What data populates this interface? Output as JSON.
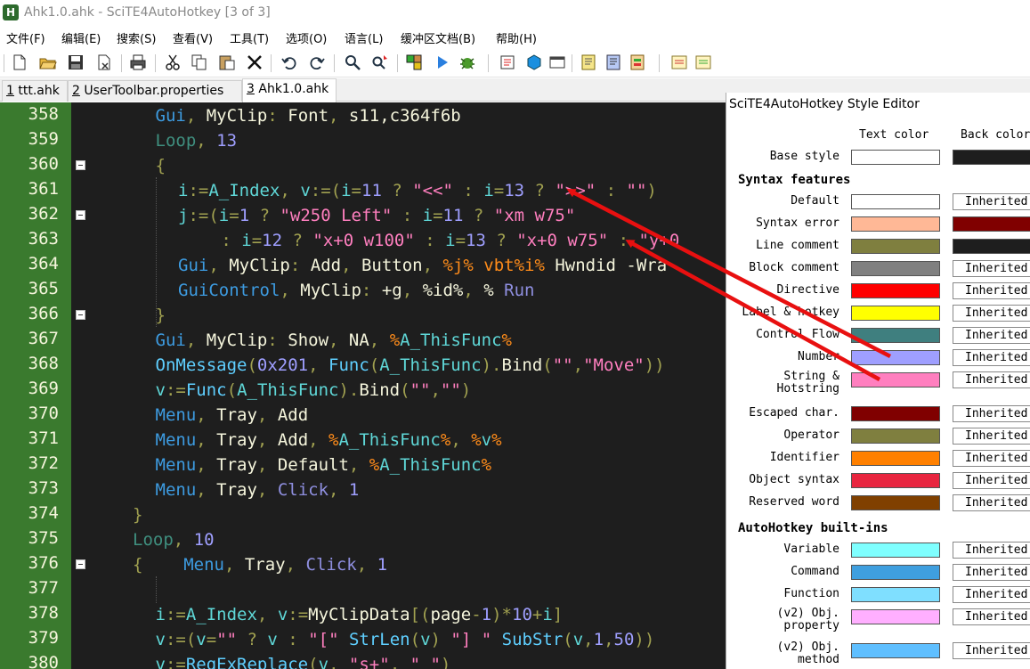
{
  "window": {
    "title": "Ahk1.0.ahk - SciTE4AutoHotkey [3 of 3]",
    "icon": "H"
  },
  "menu": [
    "文件(F)",
    "编辑(E)",
    "搜索(S)",
    "查看(V)",
    "工具(T)",
    "选项(O)",
    "语言(L)",
    "缓冲区文档(B)",
    "帮助(H)"
  ],
  "toolbar": {
    "icons": [
      "new-file-icon",
      "open-folder-icon",
      "save-icon",
      "close-file-icon",
      "print-icon",
      "cut-icon",
      "copy-icon",
      "paste-icon",
      "delete-icon",
      "undo-icon",
      "redo-icon",
      "find-icon",
      "replace-icon",
      "macro-icon",
      "run-icon",
      "debug-icon",
      "properties-icon",
      "object-icon",
      "window-icon",
      "note-icon",
      "note-2-icon",
      "note-3-icon",
      "theme-icon",
      "theme-2-icon"
    ]
  },
  "tabs": [
    {
      "num": "1",
      "label": " ttt.ahk"
    },
    {
      "num": "2",
      "label": " UserToolbar.properties"
    },
    {
      "num": "3",
      "label": " Ahk1.0.ahk"
    }
  ],
  "editor": {
    "line_numbers": [
      "358",
      "359",
      "360",
      "361",
      "362",
      "363",
      "364",
      "365",
      "366",
      "367",
      "368",
      "369",
      "370",
      "371",
      "372",
      "373",
      "374",
      "375",
      "376",
      "377",
      "378",
      "379",
      "380"
    ],
    "lines": [
      [
        [
          "t-cmd",
          "Gui"
        ],
        [
          "t-op",
          ", "
        ],
        [
          "t-text",
          "MyClip"
        ],
        [
          "t-op",
          ": "
        ],
        [
          "t-text",
          "Font"
        ],
        [
          "t-op",
          ", "
        ],
        [
          "t-text",
          "s11,c364f6b"
        ]
      ],
      [
        [
          "t-ctrl",
          "Loop"
        ],
        [
          "t-op",
          ", "
        ],
        [
          "t-num",
          "13"
        ]
      ],
      [
        [
          "t-op",
          "{"
        ]
      ],
      [
        [
          "t-var",
          "i"
        ],
        [
          "t-op",
          ":="
        ],
        [
          "t-var",
          "A_Index"
        ],
        [
          "t-op",
          ", "
        ],
        [
          "t-var",
          "v"
        ],
        [
          "t-op",
          ":=("
        ],
        [
          "t-var",
          "i"
        ],
        [
          "t-op",
          "="
        ],
        [
          "t-num",
          "11"
        ],
        [
          "t-op",
          " ? "
        ],
        [
          "t-str",
          "\"<<\""
        ],
        [
          "t-op",
          " : "
        ],
        [
          "t-var",
          "i"
        ],
        [
          "t-op",
          "="
        ],
        [
          "t-num",
          "13"
        ],
        [
          "t-op",
          " ? "
        ],
        [
          "t-str",
          "\">>\""
        ],
        [
          "t-op",
          " : "
        ],
        [
          "t-str",
          "\"\""
        ],
        [
          "t-op",
          ")"
        ]
      ],
      [
        [
          "t-var",
          "j"
        ],
        [
          "t-op",
          ":=("
        ],
        [
          "t-var",
          "i"
        ],
        [
          "t-op",
          "="
        ],
        [
          "t-num",
          "1"
        ],
        [
          "t-op",
          " ? "
        ],
        [
          "t-str",
          "\"w250 Left\""
        ],
        [
          "t-op",
          " : "
        ],
        [
          "t-var",
          "i"
        ],
        [
          "t-op",
          "="
        ],
        [
          "t-num",
          "11"
        ],
        [
          "t-op",
          " ? "
        ],
        [
          "t-str",
          "\"xm w75\""
        ]
      ],
      [
        [
          "t-op",
          "  : "
        ],
        [
          "t-var",
          "i"
        ],
        [
          "t-op",
          "="
        ],
        [
          "t-num",
          "12"
        ],
        [
          "t-op",
          " ? "
        ],
        [
          "t-str",
          "\"x+0 w100\""
        ],
        [
          "t-op",
          " : "
        ],
        [
          "t-var",
          "i"
        ],
        [
          "t-op",
          "="
        ],
        [
          "t-num",
          "13"
        ],
        [
          "t-op",
          " ? "
        ],
        [
          "t-str",
          "\"x+0 w75\""
        ],
        [
          "t-op",
          " : "
        ],
        [
          "t-str",
          "\"y+0"
        ]
      ],
      [
        [
          "t-cmd",
          "Gui"
        ],
        [
          "t-op",
          ", "
        ],
        [
          "t-text",
          "MyClip"
        ],
        [
          "t-op",
          ": "
        ],
        [
          "t-text",
          "Add"
        ],
        [
          "t-op",
          ", "
        ],
        [
          "t-text",
          "Button"
        ],
        [
          "t-op",
          ", "
        ],
        [
          "t-id",
          "%j%"
        ],
        [
          "t-text",
          " "
        ],
        [
          "t-id",
          "vbt%i%"
        ],
        [
          "t-text",
          " Hwndid -Wra"
        ]
      ],
      [
        [
          "t-cmd",
          "GuiControl"
        ],
        [
          "t-op",
          ", "
        ],
        [
          "t-text",
          "MyClip"
        ],
        [
          "t-op",
          ": "
        ],
        [
          "t-text",
          "+g"
        ],
        [
          "t-op",
          ", "
        ],
        [
          "t-text",
          "%id%"
        ],
        [
          "t-op",
          ", "
        ],
        [
          "t-text",
          "% "
        ],
        [
          "t-kw",
          "Run"
        ]
      ],
      [
        [
          "t-op",
          "}"
        ]
      ],
      [
        [
          "t-cmd",
          "Gui"
        ],
        [
          "t-op",
          ", "
        ],
        [
          "t-text",
          "MyClip"
        ],
        [
          "t-op",
          ": "
        ],
        [
          "t-text",
          "Show"
        ],
        [
          "t-op",
          ", "
        ],
        [
          "t-text",
          "NA"
        ],
        [
          "t-op",
          ", "
        ],
        [
          "t-id",
          "%"
        ],
        [
          "t-var",
          "A_ThisFunc"
        ],
        [
          "t-id",
          "%"
        ]
      ],
      [
        [
          "t-func",
          "OnMessage"
        ],
        [
          "t-op",
          "("
        ],
        [
          "t-num",
          "0x201"
        ],
        [
          "t-op",
          ", "
        ],
        [
          "t-func",
          "Func"
        ],
        [
          "t-op",
          "("
        ],
        [
          "t-var",
          "A_ThisFunc"
        ],
        [
          "t-op",
          ")."
        ],
        [
          "t-text",
          "Bind"
        ],
        [
          "t-op",
          "("
        ],
        [
          "t-str",
          "\"\""
        ],
        [
          "t-op",
          ","
        ],
        [
          "t-str",
          "\"Move\""
        ],
        [
          "t-op",
          "))"
        ]
      ],
      [
        [
          "t-var",
          "v"
        ],
        [
          "t-op",
          ":="
        ],
        [
          "t-func",
          "Func"
        ],
        [
          "t-op",
          "("
        ],
        [
          "t-var",
          "A_ThisFunc"
        ],
        [
          "t-op",
          ")."
        ],
        [
          "t-text",
          "Bind"
        ],
        [
          "t-op",
          "("
        ],
        [
          "t-str",
          "\"\""
        ],
        [
          "t-op",
          ","
        ],
        [
          "t-str",
          "\"\""
        ],
        [
          "t-op",
          ")"
        ]
      ],
      [
        [
          "t-cmd",
          "Menu"
        ],
        [
          "t-op",
          ", "
        ],
        [
          "t-text",
          "Tray"
        ],
        [
          "t-op",
          ", "
        ],
        [
          "t-text",
          "Add"
        ]
      ],
      [
        [
          "t-cmd",
          "Menu"
        ],
        [
          "t-op",
          ", "
        ],
        [
          "t-text",
          "Tray"
        ],
        [
          "t-op",
          ", "
        ],
        [
          "t-text",
          "Add"
        ],
        [
          "t-op",
          ", "
        ],
        [
          "t-id",
          "%"
        ],
        [
          "t-var",
          "A_ThisFunc"
        ],
        [
          "t-id",
          "%"
        ],
        [
          "t-op",
          ", "
        ],
        [
          "t-id",
          "%"
        ],
        [
          "t-var",
          "v"
        ],
        [
          "t-id",
          "%"
        ]
      ],
      [
        [
          "t-cmd",
          "Menu"
        ],
        [
          "t-op",
          ", "
        ],
        [
          "t-text",
          "Tray"
        ],
        [
          "t-op",
          ", "
        ],
        [
          "t-text",
          "Default"
        ],
        [
          "t-op",
          ", "
        ],
        [
          "t-id",
          "%"
        ],
        [
          "t-var",
          "A_ThisFunc"
        ],
        [
          "t-id",
          "%"
        ]
      ],
      [
        [
          "t-cmd",
          "Menu"
        ],
        [
          "t-op",
          ", "
        ],
        [
          "t-text",
          "Tray"
        ],
        [
          "t-op",
          ", "
        ],
        [
          "t-kw",
          "Click"
        ],
        [
          "t-op",
          ", "
        ],
        [
          "t-num",
          "1"
        ]
      ],
      [
        [
          "t-op",
          "}"
        ]
      ],
      [
        [
          "t-ctrl",
          "Loop"
        ],
        [
          "t-op",
          ", "
        ],
        [
          "t-num",
          "10"
        ]
      ],
      [
        [
          "t-op",
          "{    "
        ],
        [
          "t-cmd",
          "Menu"
        ],
        [
          "t-op",
          ", "
        ],
        [
          "t-text",
          "Tray"
        ],
        [
          "t-op",
          ", "
        ],
        [
          "t-kw",
          "Click"
        ],
        [
          "t-op",
          ", "
        ],
        [
          "t-num",
          "1"
        ]
      ],
      [],
      [
        [
          "t-var",
          "i"
        ],
        [
          "t-op",
          ":="
        ],
        [
          "t-var",
          "A_Index"
        ],
        [
          "t-op",
          ", "
        ],
        [
          "t-var",
          "v"
        ],
        [
          "t-op",
          ":="
        ],
        [
          "t-text",
          "MyClipData"
        ],
        [
          "t-op",
          "[("
        ],
        [
          "t-text",
          "page"
        ],
        [
          "t-op",
          "-"
        ],
        [
          "t-num",
          "1"
        ],
        [
          "t-op",
          ")*"
        ],
        [
          "t-num",
          "10"
        ],
        [
          "t-op",
          "+"
        ],
        [
          "t-var",
          "i"
        ],
        [
          "t-op",
          "]"
        ]
      ],
      [
        [
          "t-var",
          "v"
        ],
        [
          "t-op",
          ":=("
        ],
        [
          "t-var",
          "v"
        ],
        [
          "t-op",
          "="
        ],
        [
          "t-str",
          "\"\""
        ],
        [
          "t-op",
          " ? "
        ],
        [
          "t-var",
          "v"
        ],
        [
          "t-op",
          " : "
        ],
        [
          "t-str",
          "\"[\""
        ],
        [
          "t-op",
          " "
        ],
        [
          "t-func",
          "StrLen"
        ],
        [
          "t-op",
          "("
        ],
        [
          "t-var",
          "v"
        ],
        [
          "t-op",
          ") "
        ],
        [
          "t-str",
          "\"] \""
        ],
        [
          "t-op",
          " "
        ],
        [
          "t-func",
          "SubStr"
        ],
        [
          "t-op",
          "("
        ],
        [
          "t-var",
          "v"
        ],
        [
          "t-op",
          ","
        ],
        [
          "t-num",
          "1"
        ],
        [
          "t-op",
          ","
        ],
        [
          "t-num",
          "50"
        ],
        [
          "t-op",
          "))"
        ]
      ],
      [
        [
          "t-var",
          "v"
        ],
        [
          "t-op",
          ":="
        ],
        [
          "t-func",
          "RegExReplace"
        ],
        [
          "t-op",
          "("
        ],
        [
          "t-var",
          "v"
        ],
        [
          "t-op",
          ", "
        ],
        [
          "t-str",
          "\"s+\""
        ],
        [
          "t-op",
          ", "
        ],
        [
          "t-str",
          "\" \""
        ],
        [
          "t-op",
          ")"
        ]
      ]
    ],
    "line_indents": [
      3,
      3,
      3,
      4,
      4,
      5,
      4,
      4,
      3,
      3,
      3,
      3,
      3,
      3,
      3,
      3,
      2,
      2,
      2,
      2,
      3,
      3,
      3
    ],
    "fold_marks": [
      "360",
      "362",
      "366",
      "376"
    ]
  },
  "style_editor": {
    "title": "SciTE4AutoHotkey Style Editor",
    "text_color_header": "Text color",
    "back_color_header": "Back color",
    "base_style": {
      "label": "Base style",
      "text": "#ffffff",
      "back": "#1e1e1e"
    },
    "sections": [
      {
        "title": "Syntax features",
        "rows": [
          {
            "label": "Default",
            "text": "#ffffff",
            "back": "Inherited"
          },
          {
            "label": "Syntax error",
            "text": "#ffb896",
            "back": "#800000"
          },
          {
            "label": "Line comment",
            "text": "#7f7f3f",
            "back": "#1e1e1e"
          },
          {
            "label": "Block comment",
            "text": "#808080",
            "back": "Inherited"
          },
          {
            "label": "Directive",
            "text": "#ff0000",
            "back": "Inherited"
          },
          {
            "label": "Label & hotkey",
            "text": "#ffff00",
            "back": "Inherited"
          },
          {
            "label": "Control Flow",
            "text": "#3f7f7f",
            "back": "Inherited"
          },
          {
            "label": "Number",
            "text": "#9f9fff",
            "back": "Inherited"
          },
          {
            "label": "String &\nHotstring",
            "text": "#ff7fbf",
            "back": "Inherited"
          },
          {
            "label": "Escaped char.",
            "text": "#800000",
            "back": "Inherited"
          },
          {
            "label": "Operator",
            "text": "#7f7f3f",
            "back": "Inherited"
          },
          {
            "label": "Identifier",
            "text": "#ff8000",
            "back": "Inherited"
          },
          {
            "label": "Object syntax",
            "text": "#e8253f",
            "back": "Inherited"
          },
          {
            "label": "Reserved word",
            "text": "#804000",
            "back": "Inherited"
          }
        ]
      },
      {
        "title": "AutoHotkey built-ins",
        "rows": [
          {
            "label": "Variable",
            "text": "#7fffff",
            "back": "Inherited"
          },
          {
            "label": "Command",
            "text": "#3f9fdf",
            "back": "Inherited"
          },
          {
            "label": "Function",
            "text": "#7fdfff",
            "back": "Inherited"
          },
          {
            "label": "(v2) Obj.\nproperty",
            "text": "#ffafff",
            "back": "Inherited"
          },
          {
            "label": "(v2) Obj.\nmethod",
            "text": "#5fbfff",
            "back": "Inherited"
          }
        ]
      }
    ]
  },
  "annotation_color": "#e81010"
}
